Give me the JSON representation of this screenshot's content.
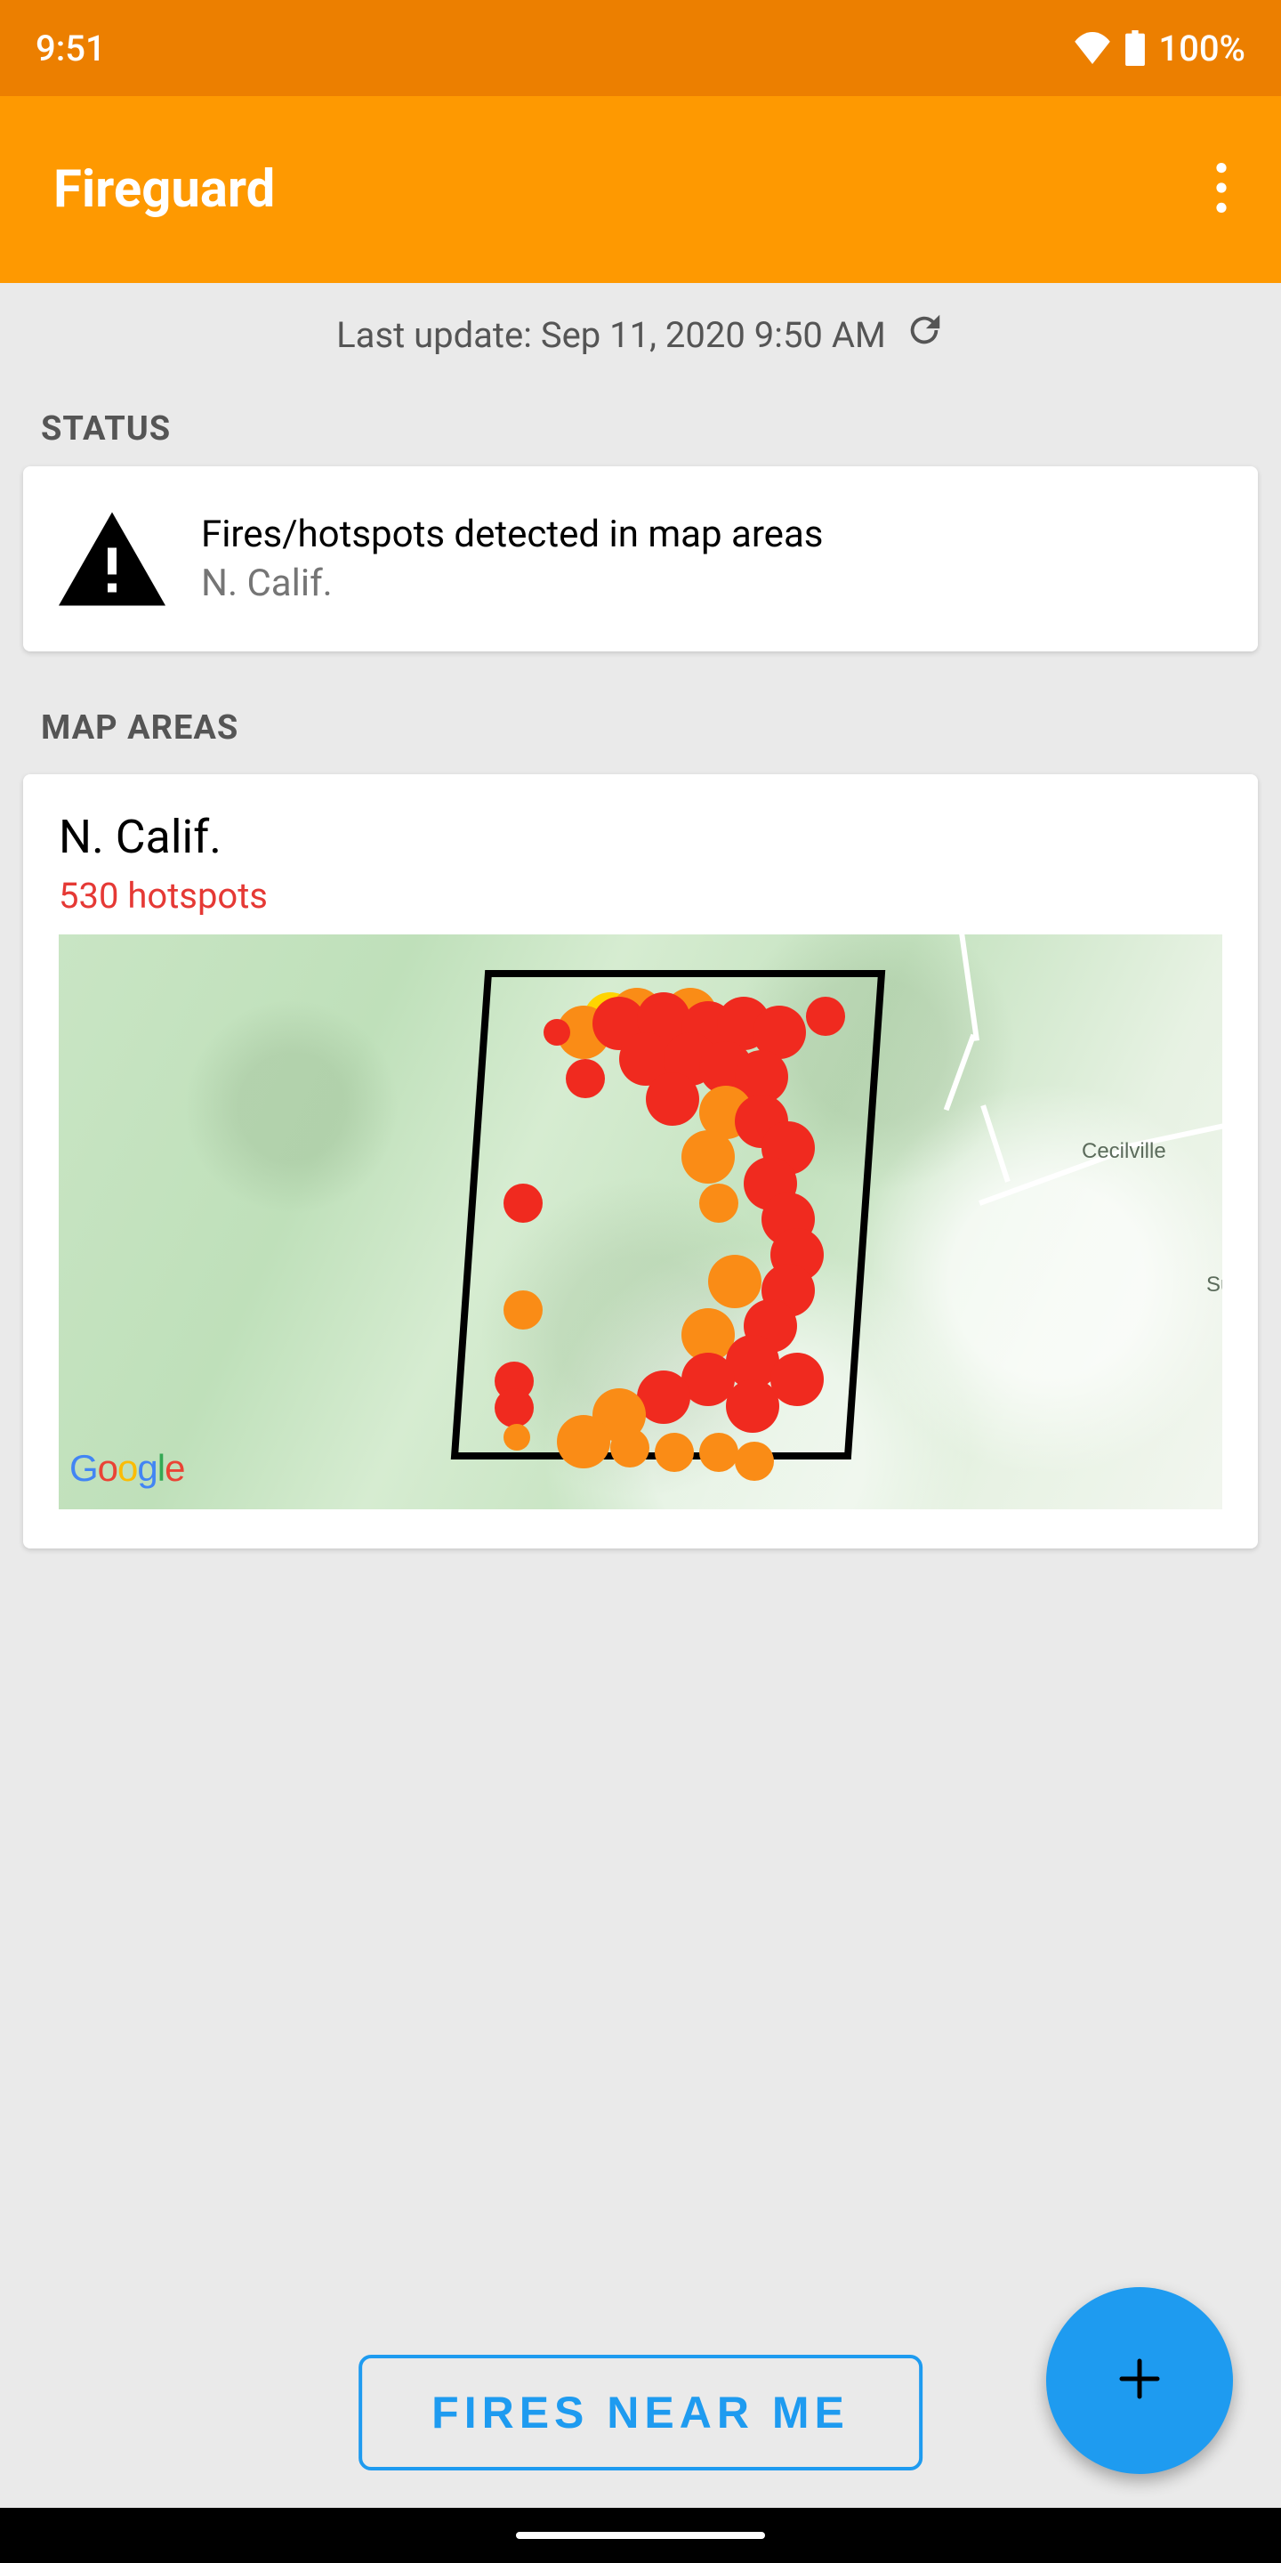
{
  "status_bar": {
    "time": "9:51",
    "battery": "100%"
  },
  "app_bar": {
    "title": "Fireguard"
  },
  "update": {
    "text": "Last update: Sep 11, 2020 9:50 AM"
  },
  "sections": {
    "status_label": "STATUS",
    "map_areas_label": "MAP AREAS"
  },
  "status_card": {
    "headline": "Fires/hotspots detected in map areas",
    "subline": "N. Calif."
  },
  "map_card": {
    "area_name": "N. Calif.",
    "hotspot_text": "530 hotspots",
    "labels": {
      "cecilville": "Cecilville",
      "summe": "Summe"
    },
    "attribution": "Google"
  },
  "actions": {
    "fires_near_me": "FIRES NEAR ME"
  }
}
